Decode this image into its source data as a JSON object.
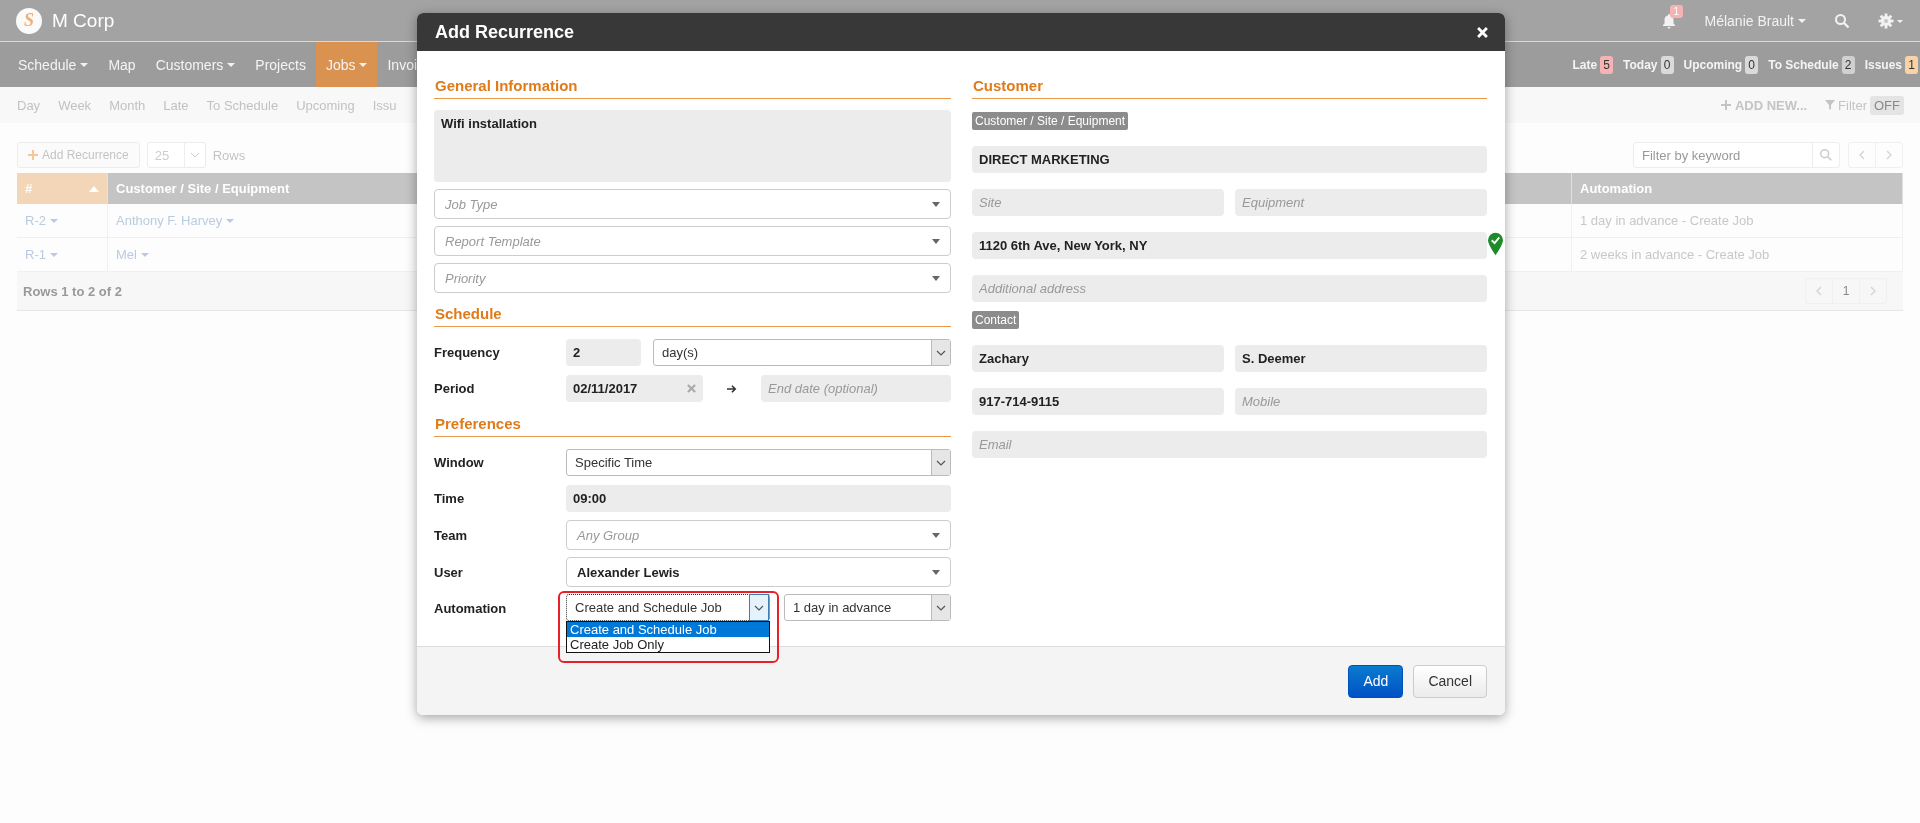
{
  "app": {
    "logo_letter": "S",
    "name": "M Corp"
  },
  "top_bar": {
    "notifications": "1",
    "user": "Mélanie Brault"
  },
  "nav": [
    {
      "label": "Schedule",
      "dropdown": true,
      "selected": false
    },
    {
      "label": "Map",
      "dropdown": false,
      "selected": false
    },
    {
      "label": "Customers",
      "dropdown": true,
      "selected": false
    },
    {
      "label": "Projects",
      "dropdown": false,
      "selected": false
    },
    {
      "label": "Jobs",
      "dropdown": true,
      "selected": true
    },
    {
      "label": "Invoi",
      "dropdown": false,
      "selected": false
    }
  ],
  "counters": [
    {
      "label": "Late",
      "count": "5",
      "color": "#f5b3b3"
    },
    {
      "label": "Today",
      "count": "0",
      "color": "#dadada"
    },
    {
      "label": "Upcoming",
      "count": "0",
      "color": "#dadada"
    },
    {
      "label": "To Schedule",
      "count": "2",
      "color": "#d0d0d0"
    },
    {
      "label": "Issues",
      "count": "1",
      "color": "#f9d3a8"
    }
  ],
  "subnav": [
    "Day",
    "Week",
    "Month",
    "Late",
    "To Schedule",
    "Upcoming",
    "Issu"
  ],
  "add_new": "ADD NEW...",
  "filter": {
    "label": "Filter",
    "state": "OFF"
  },
  "toolbar": {
    "add_button": "Add Recurrence",
    "rows_per_page": "25",
    "rows_label": "Rows",
    "search_placeholder": "Filter by keyword"
  },
  "table": {
    "columns": [
      {
        "label": "#",
        "sorted": true
      },
      {
        "label": "Customer / Site / Equipment",
        "sorted": false
      },
      {
        "label": "Automation",
        "sorted": false
      }
    ],
    "rows": [
      {
        "number": "R-2",
        "customer": "Anthony F. Harvey",
        "automation": "1 day in advance - Create Job"
      },
      {
        "number": "R-1",
        "customer": "Mel",
        "automation": "2 weeks in advance - Create Job"
      }
    ],
    "footer": "Rows 1 to 2 of 2",
    "page": "1"
  },
  "dialog": {
    "title": "Add Recurrence",
    "general": {
      "heading": "General Information",
      "description": "Wifi installation",
      "selects": [
        {
          "placeholder": "Job Type"
        },
        {
          "placeholder": "Report Template"
        },
        {
          "placeholder": "Priority"
        }
      ]
    },
    "schedule": {
      "heading": "Schedule",
      "frequency": {
        "label": "Frequency",
        "value": "2",
        "unit": "day(s)"
      },
      "period": {
        "label": "Period",
        "start": "02/11/2017",
        "end_placeholder": "End date (optional)"
      }
    },
    "preferences": {
      "heading": "Preferences",
      "rows": [
        {
          "label": "Window",
          "kind": "native",
          "value": "Specific Time"
        },
        {
          "label": "Time",
          "kind": "text",
          "value": "09:00"
        },
        {
          "label": "Team",
          "kind": "combo",
          "placeholder": "Any Group"
        },
        {
          "label": "User",
          "kind": "combo",
          "value": "Alexander Lewis"
        }
      ],
      "automation": {
        "label": "Automation",
        "value": "Create and Schedule Job",
        "open": true,
        "highlighted": true,
        "options": [
          {
            "label": "Create and Schedule Job",
            "selected": true
          },
          {
            "label": "Create Job Only",
            "selected": false
          }
        ],
        "advance": "1 day in advance"
      }
    },
    "customer": {
      "heading": "Customer",
      "site_badge": "Customer / Site / Equipment",
      "customer": "DIRECT MARKETING",
      "site_placeholder": "Site",
      "equipment_placeholder": "Equipment",
      "address": "1120 6th Ave, New York, NY",
      "address_verified": true,
      "additional_placeholder": "Additional address",
      "contact_badge": "Contact",
      "first_name": "Zachary",
      "last_name": "S. Deemer",
      "phone": "917-714-9115",
      "mobile_placeholder": "Mobile",
      "email_placeholder": "Email"
    },
    "buttons": [
      {
        "label": "Add",
        "kind": "primary"
      },
      {
        "label": "Cancel",
        "kind": "default"
      }
    ]
  }
}
